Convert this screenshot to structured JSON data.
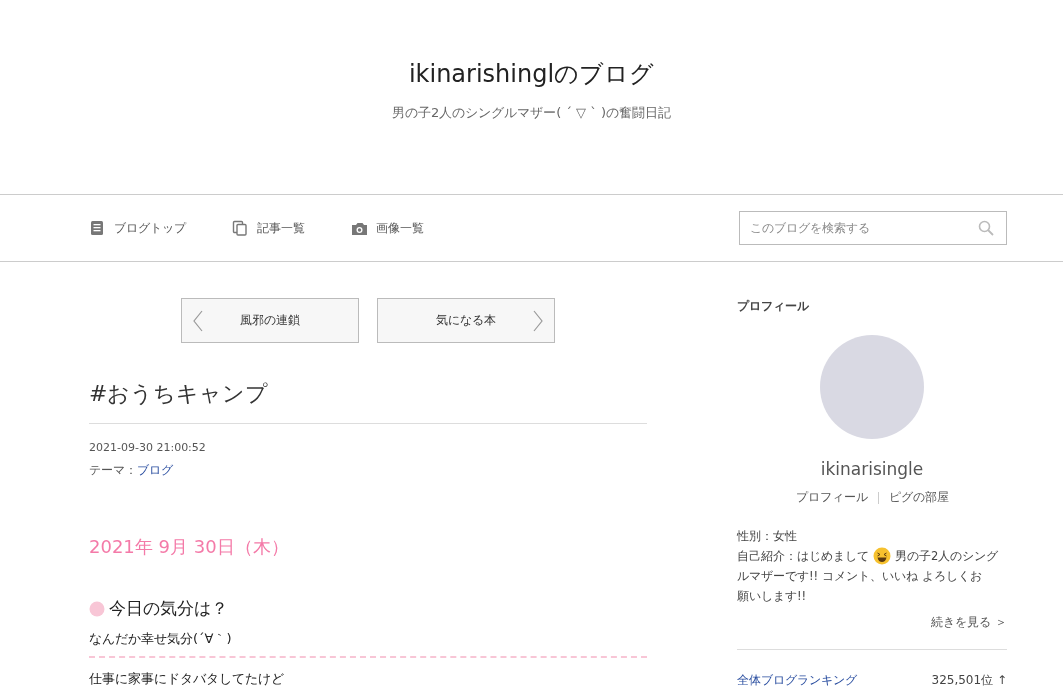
{
  "header": {
    "title": "ikinarishinglのブログ",
    "subtitle": "男の子2人のシングルマザー( ´ ▽ ` )の奮闘日記"
  },
  "nav": {
    "items": [
      {
        "kind": "top",
        "label": "ブログトップ"
      },
      {
        "kind": "list",
        "label": "記事一覧"
      },
      {
        "kind": "images",
        "label": "画像一覧"
      }
    ],
    "search": {
      "placeholder": "このブログを検索する"
    }
  },
  "pager": {
    "prev": "風邪の連鎖",
    "next": "気になる本"
  },
  "article": {
    "title": "#おうちキャンプ",
    "datetime": "2021-09-30 21:00:52",
    "theme_label": "テーマ：",
    "theme": "ブログ",
    "date_heading": "2021年 9月 30日（木）",
    "mood_heading": "今日の気分は？",
    "mood": "なんだか幸せ気分(´∀｀)",
    "body": "仕事に家事にドタバタしてたけど"
  },
  "sidebar": {
    "heading": "プロフィール",
    "name": "ikinarisingle",
    "links": [
      "プロフィール",
      "ピグの部屋"
    ],
    "gender": "性別：女性",
    "intro_before": "自己紹介：はじめまして",
    "intro_lines": [
      "男の子2人のシング",
      "ルマザーです!! コメント、いいね よろしくお",
      "願いします!!"
    ],
    "more": "続きを見る ＞",
    "rankings": [
      {
        "label": "全体ブログランキング",
        "rank": "325,501位 ↑"
      }
    ]
  }
}
